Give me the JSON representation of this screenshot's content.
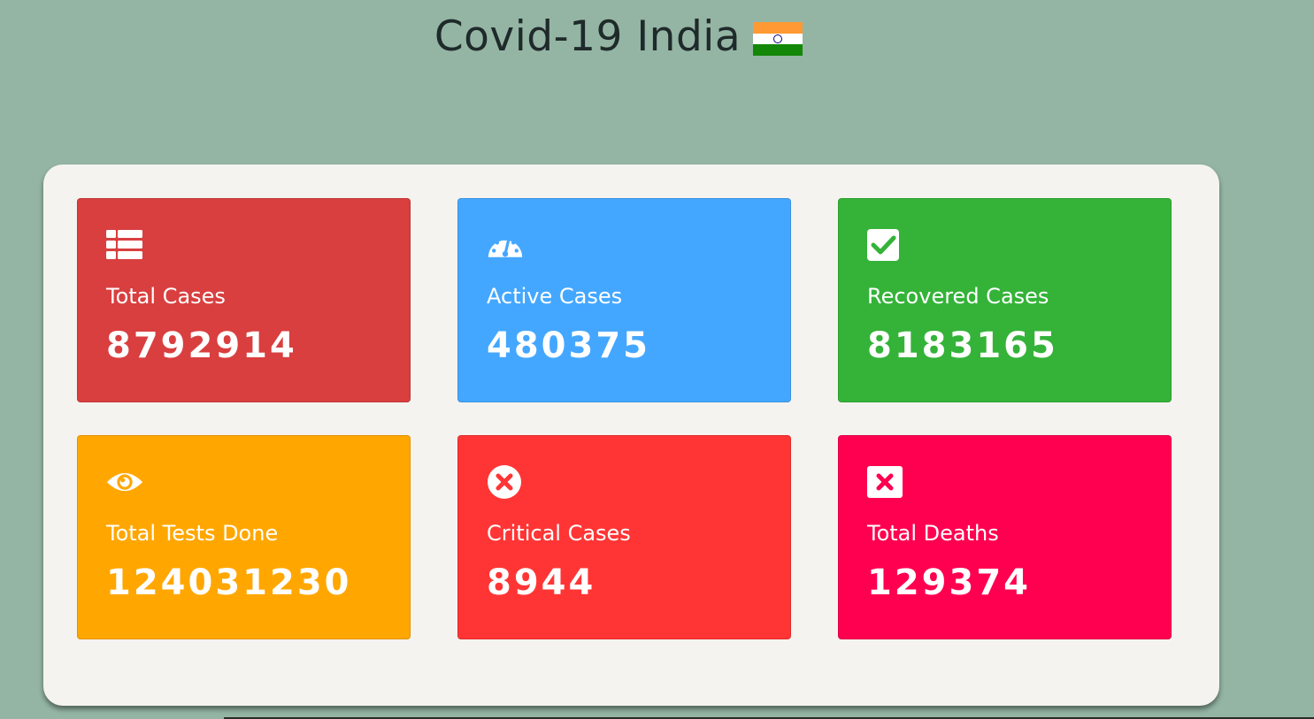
{
  "header": {
    "title": "Covid-19 India",
    "flag_icon": "india-flag-icon"
  },
  "colors": {
    "background": "#94b5a4",
    "board": "#f5f3ef",
    "total_cases": "#d93f3f",
    "active_cases": "#44a7ff",
    "recovered_cases": "#34b338",
    "total_tests": "#ffa700",
    "critical_cases": "#ff3535",
    "total_deaths": "#ff0050"
  },
  "cards": [
    {
      "id": "total-cases",
      "label": "Total Cases",
      "value": "8792914",
      "icon": "table-list-icon",
      "color": "#d93f3f"
    },
    {
      "id": "active-cases",
      "label": "Active Cases",
      "value": "480375",
      "icon": "speedometer-icon",
      "color": "#44a7ff"
    },
    {
      "id": "recovered-cases",
      "label": "Recovered Cases",
      "value": "8183165",
      "icon": "check-square-icon",
      "color": "#34b338"
    },
    {
      "id": "total-tests",
      "label": "Total Tests Done",
      "value": "124031230",
      "icon": "eye-icon",
      "color": "#ffa700"
    },
    {
      "id": "critical-cases",
      "label": "Critical Cases",
      "value": "8944",
      "icon": "times-circle-icon",
      "color": "#ff3535"
    },
    {
      "id": "total-deaths",
      "label": "Total Deaths",
      "value": "129374",
      "icon": "times-square-icon",
      "color": "#ff0050"
    }
  ]
}
